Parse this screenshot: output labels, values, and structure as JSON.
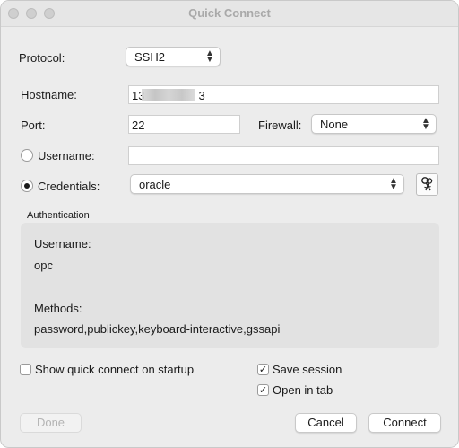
{
  "window": {
    "title": "Quick Connect"
  },
  "protocol": {
    "label": "Protocol:",
    "value": "SSH2"
  },
  "hostname": {
    "label": "Hostname:",
    "prefix": "13",
    "suffix": "3"
  },
  "port": {
    "label": "Port:",
    "value": "22"
  },
  "firewall": {
    "label": "Firewall:",
    "value": "None"
  },
  "username": {
    "label": "Username:",
    "value": ""
  },
  "credentials": {
    "label": "Credentials:",
    "value": "oracle"
  },
  "authentication": {
    "heading": "Authentication",
    "username_label": "Username:",
    "username_value": "opc",
    "methods_label": "Methods:",
    "methods_value": "password,publickey,keyboard-interactive,gssapi"
  },
  "options": {
    "show_on_startup": {
      "label": "Show quick connect on startup",
      "checked": false
    },
    "save_session": {
      "label": "Save session",
      "checked": true
    },
    "open_in_tab": {
      "label": "Open in tab",
      "checked": true
    }
  },
  "buttons": {
    "done": "Done",
    "cancel": "Cancel",
    "connect": "Connect"
  },
  "icons": {
    "key_button": "keys-icon",
    "popup_chevron": "up-down-chevron-icon",
    "checkmark": "✓"
  }
}
